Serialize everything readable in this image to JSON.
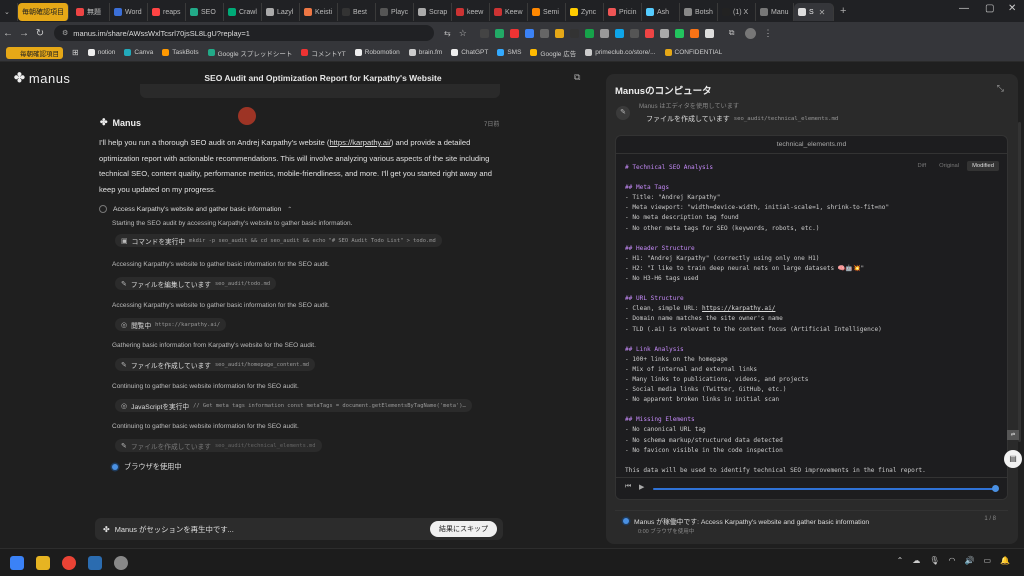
{
  "browser": {
    "tabs": [
      {
        "label": "",
        "color": "#e6a817"
      },
      {
        "label": "無題",
        "color": "#e44"
      },
      {
        "label": "Word",
        "color": "#3b6fd8"
      },
      {
        "label": "reaps",
        "color": "#f44"
      },
      {
        "label": "SEO",
        "color": "#2a8"
      },
      {
        "label": "Crawl",
        "color": "#0a7"
      },
      {
        "label": "Lazyl",
        "color": "#aaa"
      },
      {
        "label": "Keisti",
        "color": "#e74"
      },
      {
        "label": "Best",
        "color": "#333"
      },
      {
        "label": "Playc",
        "color": "#555"
      },
      {
        "label": "Scrap",
        "color": "#aaa"
      },
      {
        "label": "keew",
        "color": "#c33"
      },
      {
        "label": "Keew",
        "color": "#c33"
      },
      {
        "label": "Semi",
        "color": "#f80"
      },
      {
        "label": "Zync",
        "color": "#fc0"
      },
      {
        "label": "Pricin",
        "color": "#e55"
      },
      {
        "label": "Ash",
        "color": "#5cf"
      },
      {
        "label": "Botsh",
        "color": "#888"
      },
      {
        "label": "(1) X",
        "color": "#222"
      },
      {
        "label": "Manu",
        "color": "#777"
      },
      {
        "label": "S",
        "color": "#ddd",
        "active": true
      }
    ],
    "group_label": "毎朝確認項目",
    "new_tab": "+",
    "url": "manus.im/share/AWssWxlTcsrl70jsSL8LgU?replay=1",
    "bookmarks": [
      {
        "label": "毎朝確認項目",
        "color": "#e6a817"
      },
      {
        "label": "notion",
        "color": "#eee"
      },
      {
        "label": "Canva",
        "color": "#2ab"
      },
      {
        "label": "TaskBots",
        "color": "#f90"
      },
      {
        "label": "Google スプレッドシート",
        "color": "#2a8"
      },
      {
        "label": "コメントYT",
        "color": "#e33"
      },
      {
        "label": "Robomotion",
        "color": "#eee"
      },
      {
        "label": "brain.fm",
        "color": "#ccc"
      },
      {
        "label": "ChatGPT",
        "color": "#eee"
      },
      {
        "label": "SMS",
        "color": "#3af"
      },
      {
        "label": "Google 広告",
        "color": "#fb0"
      },
      {
        "label": "primeclub.co/store/...",
        "color": "#ccc"
      },
      {
        "label": "CONFIDENTIAL",
        "color": "#e6a817"
      }
    ]
  },
  "app": {
    "logo": "manus",
    "title": "SEO Audit and Optimization Report for Karpathy's Website"
  },
  "chat": {
    "agent_name": "Manus",
    "time": "7日前",
    "intro_before": "I'll help you run a thorough SEO audit on Andrej Karpathy's website (",
    "intro_link": "https://karpathy.ai/",
    "intro_after": ") and provide a detailed optimization report with actionable recommendations. This will involve analyzing various aspects of the site including technical SEO, content quality, performance metrics, mobile-friendliness, and more. I'll get you started right away and keep you updated on my progress.",
    "task_title": "Access Karpathy's website and gather basic information",
    "steps": [
      {
        "text": "Starting the SEO audit by accessing Karpathy's website to gather basic information.",
        "chip": "コマンドを実行中",
        "arg": "mkdir -p seo_audit && cd seo_audit && echo \"# SEO Audit Todo List\" > todo.md",
        "icon": "▣"
      },
      {
        "text": "Accessing Karpathy's website to gather basic information for the SEO audit.",
        "chip": "ファイルを編集しています",
        "arg": "seo_audit/todo.md",
        "icon": "✎"
      },
      {
        "text": "Accessing Karpathy's website to gather basic information for the SEO audit.",
        "chip": "閲覧中",
        "arg": "https://karpathy.ai/",
        "icon": "◎"
      },
      {
        "text": "Gathering basic information from Karpathy's website for the SEO audit.",
        "chip": "ファイルを作成しています",
        "arg": "seo_audit/homepage_content.md",
        "icon": "✎"
      },
      {
        "text": "Continuing to gather basic website information for the SEO audit.",
        "chip": "JavaScriptを実行中",
        "arg": "// Get meta tags information const metaTags = document.getElementsByTagName('meta')…",
        "icon": "◎"
      },
      {
        "text": "Continuing to gather basic website information for the SEO audit.",
        "chip": "ファイルを作成しています",
        "arg": "seo_audit/technical_elements.md",
        "icon": "✎",
        "dim": true
      }
    ],
    "browser_status": "ブラウザを使用中",
    "replay_text": "Manus がセッションを再生中です...",
    "skip_label": "結果にスキップ"
  },
  "computer": {
    "title": "Manusのコンピュータ",
    "sub": "Manus はエディタを使用しています",
    "action": "ファイルを作成しています",
    "action_arg": "seo_audit/technical_elements.md",
    "filename": "technical_elements.md",
    "tabs": [
      "Diff",
      "Original",
      "Modified"
    ],
    "code": [
      {
        "t": "# Technical SEO Analysis",
        "h": true
      },
      {
        "t": ""
      },
      {
        "t": "## Meta Tags",
        "h": true
      },
      {
        "t": "- Title: \"Andrej Karpathy\""
      },
      {
        "t": "- Meta viewport: \"width=device-width, initial-scale=1, shrink-to-fit=no\""
      },
      {
        "t": "- No meta description tag found"
      },
      {
        "t": "- No other meta tags for SEO (keywords, robots, etc.)"
      },
      {
        "t": ""
      },
      {
        "t": "## Header Structure",
        "h": true
      },
      {
        "t": "- H1: \"Andrej Karpathy\" (correctly using only one H1)"
      },
      {
        "t": "- H2: \"I like to train deep neural nets on large datasets 🧠🤖💥\""
      },
      {
        "t": "- No H3-H6 tags used"
      },
      {
        "t": ""
      },
      {
        "t": "## URL Structure",
        "h": true
      },
      {
        "t": "- Clean, simple URL: ",
        "link": "https://karpathy.ai/"
      },
      {
        "t": "- Domain name matches the site owner's name"
      },
      {
        "t": "- TLD (.ai) is relevant to the content focus (Artificial Intelligence)"
      },
      {
        "t": ""
      },
      {
        "t": "## Link Analysis",
        "h": true
      },
      {
        "t": "- 100+ links on the homepage"
      },
      {
        "t": "- Mix of internal and external links"
      },
      {
        "t": "- Many links to publications, videos, and projects"
      },
      {
        "t": "- Social media links (Twitter, GitHub, etc.)"
      },
      {
        "t": "- No apparent broken links in initial scan"
      },
      {
        "t": ""
      },
      {
        "t": "## Missing Elements",
        "h": true
      },
      {
        "t": "- No canonical URL tag"
      },
      {
        "t": "- No schema markup/structured data detected"
      },
      {
        "t": "- No favicon visible in the code inspection"
      },
      {
        "t": ""
      },
      {
        "t": "This data will be used to identify technical SEO improvements in the final report."
      }
    ],
    "status_main": "Manus が稼働中です: Access Karpathy's website and gather basic information",
    "status_sub": "0:00  ブラウザを使用中",
    "status_page": "1 / 8",
    "playback_progress": 0.99
  }
}
